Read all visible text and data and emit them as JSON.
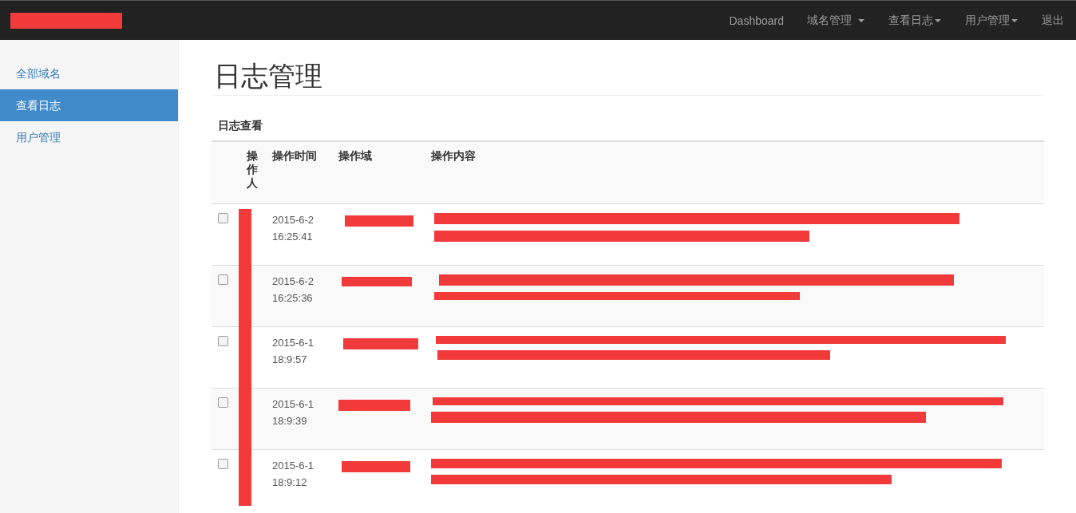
{
  "navbar": {
    "items": [
      {
        "label": "Dashboard",
        "dropdown": false
      },
      {
        "label": "域名管理",
        "dropdown": true
      },
      {
        "label": "查看日志",
        "dropdown": true
      },
      {
        "label": "用户管理",
        "dropdown": true
      },
      {
        "label": "退出",
        "dropdown": false
      }
    ]
  },
  "sidebar": {
    "items": [
      {
        "label": "全部域名",
        "selected": false
      },
      {
        "label": "查看日志",
        "selected": true
      },
      {
        "label": "用户管理",
        "selected": false
      }
    ]
  },
  "page_title": "日志管理",
  "section_title": "日志查看",
  "table": {
    "columns": [
      "操作人",
      "操作时间",
      "操作域",
      "操作内容"
    ],
    "rows": [
      {
        "checked": false,
        "date": "2015-6-2",
        "time": "16:25:41"
      },
      {
        "checked": false,
        "date": "2015-6-2",
        "time": "16:25:36"
      },
      {
        "checked": false,
        "date": "2015-6-1",
        "time": "18:9:57"
      },
      {
        "checked": false,
        "date": "2015-6-1",
        "time": "18:9:39"
      },
      {
        "checked": false,
        "date": "2015-6-1",
        "time": "18:9:12"
      }
    ]
  }
}
